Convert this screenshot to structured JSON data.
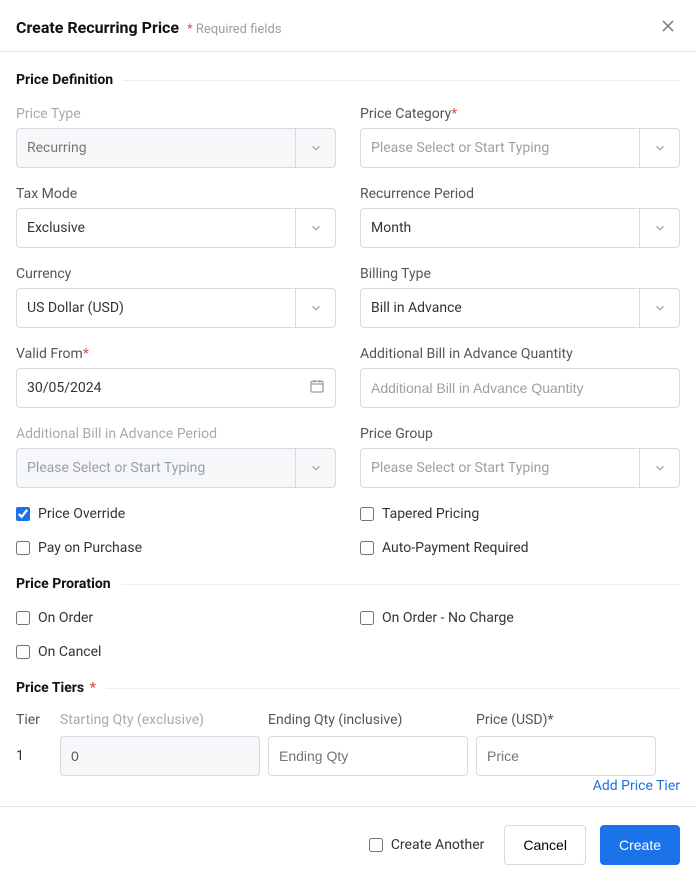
{
  "header": {
    "title": "Create Recurring Price",
    "required_note": "Required fields"
  },
  "sections": {
    "price_definition": "Price Definition",
    "price_proration": "Price Proration",
    "price_tiers": "Price Tiers"
  },
  "labels": {
    "price_type": "Price Type",
    "price_category": "Price Category",
    "tax_mode": "Tax Mode",
    "recurrence_period": "Recurrence Period",
    "currency": "Currency",
    "billing_type": "Billing Type",
    "valid_from": "Valid From",
    "additional_bia_qty": "Additional Bill in Advance Quantity",
    "additional_bia_period": "Additional Bill in Advance Period",
    "price_group": "Price Group"
  },
  "values": {
    "price_type": "Recurring",
    "tax_mode": "Exclusive",
    "recurrence_period": "Month",
    "currency": "US Dollar (USD)",
    "billing_type": "Bill in Advance",
    "valid_from": "30/05/2024"
  },
  "placeholders": {
    "select": "Please Select or Start Typing",
    "additional_bia_qty": "Additional Bill in Advance Quantity",
    "ending_qty": "Ending Qty",
    "price": "Price"
  },
  "checkboxes": {
    "price_override": {
      "label": "Price Override",
      "checked": true
    },
    "tapered_pricing": {
      "label": "Tapered Pricing",
      "checked": false
    },
    "pay_on_purchase": {
      "label": "Pay on Purchase",
      "checked": false
    },
    "auto_payment_required": {
      "label": "Auto-Payment Required",
      "checked": false
    },
    "on_order": {
      "label": "On Order",
      "checked": false
    },
    "on_order_no_charge": {
      "label": "On Order - No Charge",
      "checked": false
    },
    "on_cancel": {
      "label": "On Cancel",
      "checked": false
    }
  },
  "tiers": {
    "headers": {
      "tier": "Tier",
      "starting_qty": "Starting Qty (exclusive)",
      "ending_qty": "Ending Qty (inclusive)",
      "price": "Price (USD)"
    },
    "rows": [
      {
        "index": "1",
        "starting_qty": "0",
        "ending_qty": "",
        "price": ""
      }
    ],
    "add_link": "Add Price Tier"
  },
  "footer": {
    "create_another": "Create Another",
    "cancel": "Cancel",
    "create": "Create"
  }
}
